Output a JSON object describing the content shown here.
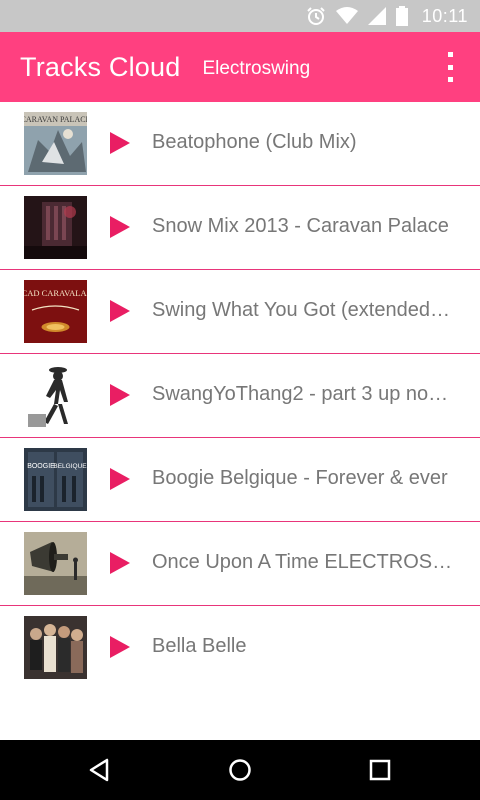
{
  "status_bar": {
    "time": "10:11",
    "icons": [
      "alarm-icon",
      "wifi-icon",
      "cell-signal-icon",
      "battery-icon"
    ]
  },
  "app_bar": {
    "title": "Tracks Cloud",
    "subtitle": "Electroswing",
    "menu_icon": "overflow-menu-icon"
  },
  "colors": {
    "accent": "#ff4080",
    "play": "#e91e63",
    "divider": "#e8357a",
    "title_text": "#777777",
    "status_bar": "#c7c7c7"
  },
  "tracks": [
    {
      "title": "Beatophone (Club Mix)",
      "art_label": "CARAVAN PALACE"
    },
    {
      "title": "Snow Mix 2013 - Caravan Palace",
      "art_label": ""
    },
    {
      "title": "Swing What You Got (extended…",
      "art_label": "CAD CARAVALAI"
    },
    {
      "title": "SwangYoThang2 - part 3 up no…",
      "art_label": ""
    },
    {
      "title": "Boogie Belgique - Forever & ever",
      "art_label": "BOOGIE BELGIQUE"
    },
    {
      "title": "Once Upon A Time ELECTROS…",
      "art_label": ""
    },
    {
      "title": "Bella Belle",
      "art_label": ""
    }
  ],
  "nav_bar": {
    "icons": [
      "back-icon",
      "home-icon",
      "recents-icon"
    ]
  }
}
